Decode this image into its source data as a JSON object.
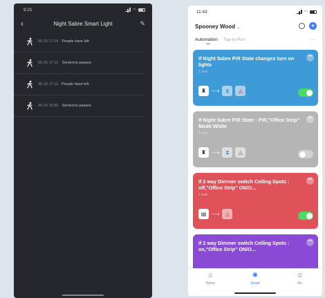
{
  "left_phone": {
    "status_time": "9:21",
    "title": "Night Sabre Smart Light",
    "logs": [
      {
        "time": "05-15 17:14",
        "event": "People have left"
      },
      {
        "time": "05-15 17:12",
        "event": "Someone passes"
      },
      {
        "time": "05-15 17:11",
        "event": "People have left"
      },
      {
        "time": "05-15 16:56",
        "event": "Someone passes"
      }
    ]
  },
  "right_phone": {
    "status_time": "11:43",
    "home_name": "Spooney Wood",
    "tabs": {
      "automation": "Automation",
      "tap_to_run": "Tap-to-Run"
    },
    "more": "···",
    "cards": [
      {
        "title": "If Night Sabre PIR State changes turn on lights",
        "sub": "1 task",
        "enabled": true,
        "color": "#3f9ad8"
      },
      {
        "title": "If Night Sabre PIR State : PIR,\"Office Strip\" Mode:White",
        "sub": "1 task",
        "enabled": false,
        "color": "#b5b5b5"
      },
      {
        "title": "If 2 way Dimmer switch Ceiling Spots : off,\"Office Strip\" ON/O...",
        "sub": "1 task",
        "enabled": true,
        "color": "#e0525a"
      },
      {
        "title": "If 2 way Dimmer switch Ceiling Spots : on,\"Office Strip\" ON/O...",
        "sub": "",
        "enabled": true,
        "color": "#8a4ad6"
      }
    ],
    "nav": {
      "home": "Home",
      "smart": "Smart",
      "me": "Me"
    }
  }
}
